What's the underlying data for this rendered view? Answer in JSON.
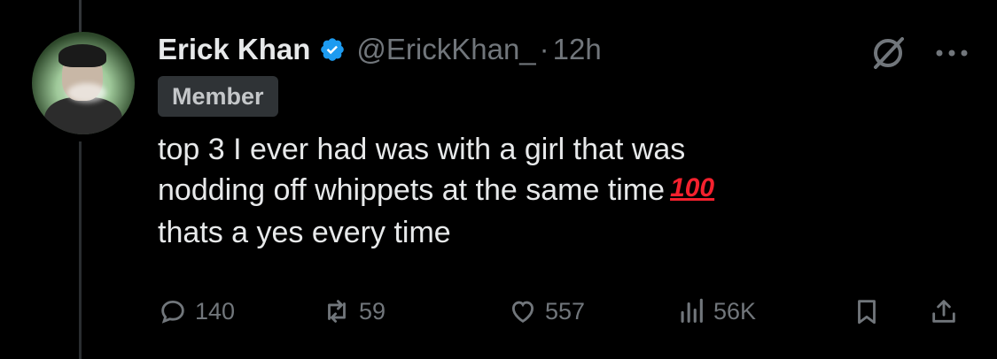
{
  "tweet": {
    "author_name": "Erick Khan",
    "handle": "@ErickKhan_",
    "separator": "·",
    "time": "12h",
    "badge": "Member",
    "text_lines": [
      "top 3 I ever had was with a girl that was",
      "nodding off whippets at the same time",
      "thats a yes every time"
    ],
    "emoji": "100"
  },
  "stats": {
    "replies": "140",
    "retweets": "59",
    "likes": "557",
    "views": "56K"
  },
  "icons": {
    "verified": "verified-badge-icon",
    "grok": "grok-icon",
    "more": "more-icon",
    "reply": "reply-icon",
    "retweet": "retweet-icon",
    "like": "heart-icon",
    "views": "views-icon",
    "bookmark": "bookmark-icon",
    "share": "share-icon"
  },
  "colors": {
    "background": "#000000",
    "text_primary": "#e7e9ea",
    "text_secondary": "#71767b",
    "verified_blue": "#1d9bf0",
    "emoji_red": "#f4212e",
    "badge_bg": "#2f3336"
  }
}
